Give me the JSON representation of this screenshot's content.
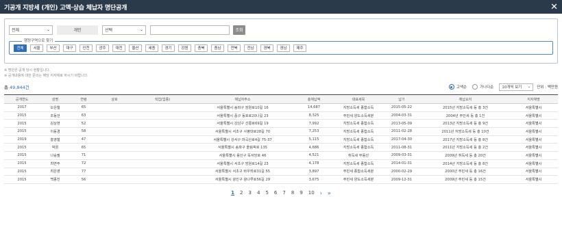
{
  "window": {
    "title": "기공개 지방세 (개인) 고액·상습 체납자 명단공개"
  },
  "filters": {
    "select1": "전체",
    "type_label": "개인",
    "select2": "선택",
    "search_value": "",
    "search_button": "조회"
  },
  "region": {
    "legend": "행정구역으로 찾기",
    "items": [
      "전체",
      "서울",
      "부산",
      "대구",
      "인천",
      "광주",
      "대전",
      "울산",
      "세종",
      "경기",
      "강원",
      "충북",
      "충남",
      "전북",
      "전남",
      "경북",
      "경남",
      "제주"
    ]
  },
  "notes": [
    "※ 명단은 공개 당시 현황입니다.",
    "※ 공개내용에 대한 문의는 해당 지자체로 하시기 바랍니다."
  ],
  "summary": {
    "total_prefix": "총 ",
    "total_value": "49,844건",
    "sort_desc": "고액순",
    "sort_asc": "가나다순",
    "page_size": "10개씩 보기",
    "unit": "단위 : 백만원"
  },
  "table": {
    "headers": [
      "공개연도",
      "성명",
      "연령",
      "상호",
      "직업(업종)",
      "체납자주소",
      "총체납액",
      "대표세목",
      "납기",
      "체납요지",
      "지자체명"
    ],
    "rows": [
      [
        "2017",
        "오은철",
        "65",
        "",
        "",
        "서울특별시 송파구 잠원로10길 16",
        "14,687",
        "지방소득세 종합소득",
        "2015-05-22",
        "2015년 지방소득세 등 총 3건",
        "서울특별시"
      ],
      [
        "2015",
        "조동언",
        "63",
        "",
        "",
        "서울특별시 중구 동호로20나길 23",
        "8,325",
        "주민세 양도소득세분",
        "2004-03-31",
        "2004년 주민세 등 총 1건",
        "서울특별시"
      ],
      [
        "2015",
        "김상현",
        "52",
        "",
        "",
        "서울특별시 강남구 선릉로69길 19",
        "7,992",
        "지방소득세 종합소득",
        "2013-05-09",
        "2013년 지방소득세 등 총 9건",
        "서울특별시"
      ],
      [
        "2015",
        "이동경",
        "58",
        "",
        "",
        "서울특별시 서초구 사평대로28길 70",
        "7,253",
        "지방소득세 종합소득",
        "2011-02-28",
        "2011년 지방소득세 등 총 10건",
        "서울특별시"
      ],
      [
        "2019",
        "홍영철",
        "47",
        "",
        "",
        "서울특별시 강서구 마곡산로4길 75-37",
        "5,115",
        "지방소득세 종합소득",
        "2017-04-30",
        "2017년 지방소득세 등 총 8건",
        "서울특별시"
      ],
      [
        "2015",
        "박원",
        "65",
        "",
        "",
        "서울특별시 송파구 올림픽로 135",
        "4,686",
        "지방소득세 종합소득",
        "2011-08-31",
        "2011년 지방소득세 등 총 2건",
        "서울특별시"
      ],
      [
        "2015",
        "나승필",
        "71",
        "",
        "",
        "서울특별시 용산구 독서당로 46",
        "4,521",
        "취득세 부동산",
        "2009-03-31",
        "2009년 취득세 등 총 20건",
        "서울특별시"
      ],
      [
        "2015",
        "최면주",
        "72",
        "",
        "",
        "서울특별시 서초구 방원로14길 23",
        "4,178",
        "지방소득세 종합소득",
        "2014-01-31",
        "2014년 지방소득세 등 총 8건",
        "서울특별시"
      ],
      [
        "2015",
        "최은영",
        "77",
        "",
        "",
        "서울특별시 서초구 바우뫼로31길 55",
        "3,897",
        "주민세 종합소득세분",
        "2000-02-29",
        "2000년 주민세 등 총 16건",
        "서울특별시"
      ],
      [
        "2015",
        "백종진",
        "56",
        "",
        "",
        "서울특별시 광진구 광나루로56길 29",
        "3,675",
        "주민세 양도소득세분",
        "2009-12-31",
        "2009년 주민세 등 총 15건",
        "서울특별시"
      ]
    ]
  },
  "pagination": {
    "pages": [
      "1",
      "2",
      "3",
      "4",
      "5",
      "6",
      "7",
      "8",
      "9",
      "10"
    ],
    "current": "1",
    "next": "›",
    "last": "»"
  }
}
